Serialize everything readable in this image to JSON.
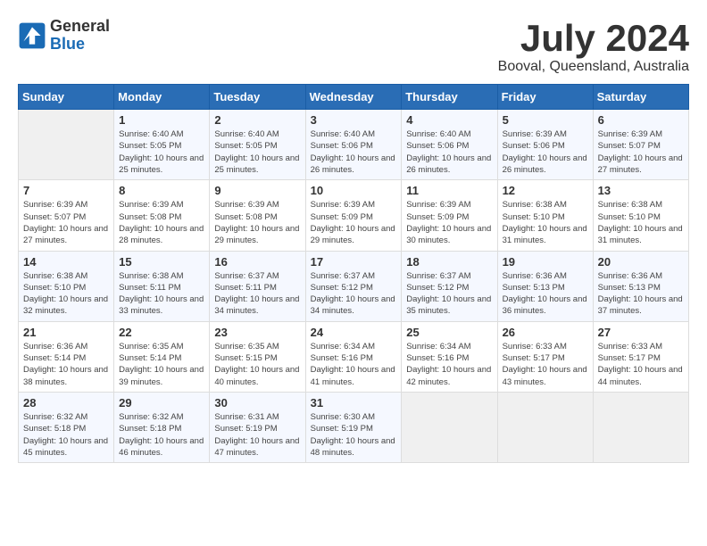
{
  "header": {
    "logo_general": "General",
    "logo_blue": "Blue",
    "month_year": "July 2024",
    "location": "Booval, Queensland, Australia"
  },
  "weekdays": [
    "Sunday",
    "Monday",
    "Tuesday",
    "Wednesday",
    "Thursday",
    "Friday",
    "Saturday"
  ],
  "weeks": [
    [
      {
        "day": "",
        "sunrise": "",
        "sunset": "",
        "daylight": ""
      },
      {
        "day": "1",
        "sunrise": "Sunrise: 6:40 AM",
        "sunset": "Sunset: 5:05 PM",
        "daylight": "Daylight: 10 hours and 25 minutes."
      },
      {
        "day": "2",
        "sunrise": "Sunrise: 6:40 AM",
        "sunset": "Sunset: 5:05 PM",
        "daylight": "Daylight: 10 hours and 25 minutes."
      },
      {
        "day": "3",
        "sunrise": "Sunrise: 6:40 AM",
        "sunset": "Sunset: 5:06 PM",
        "daylight": "Daylight: 10 hours and 26 minutes."
      },
      {
        "day": "4",
        "sunrise": "Sunrise: 6:40 AM",
        "sunset": "Sunset: 5:06 PM",
        "daylight": "Daylight: 10 hours and 26 minutes."
      },
      {
        "day": "5",
        "sunrise": "Sunrise: 6:39 AM",
        "sunset": "Sunset: 5:06 PM",
        "daylight": "Daylight: 10 hours and 26 minutes."
      },
      {
        "day": "6",
        "sunrise": "Sunrise: 6:39 AM",
        "sunset": "Sunset: 5:07 PM",
        "daylight": "Daylight: 10 hours and 27 minutes."
      }
    ],
    [
      {
        "day": "7",
        "sunrise": "Sunrise: 6:39 AM",
        "sunset": "Sunset: 5:07 PM",
        "daylight": "Daylight: 10 hours and 27 minutes."
      },
      {
        "day": "8",
        "sunrise": "Sunrise: 6:39 AM",
        "sunset": "Sunset: 5:08 PM",
        "daylight": "Daylight: 10 hours and 28 minutes."
      },
      {
        "day": "9",
        "sunrise": "Sunrise: 6:39 AM",
        "sunset": "Sunset: 5:08 PM",
        "daylight": "Daylight: 10 hours and 29 minutes."
      },
      {
        "day": "10",
        "sunrise": "Sunrise: 6:39 AM",
        "sunset": "Sunset: 5:09 PM",
        "daylight": "Daylight: 10 hours and 29 minutes."
      },
      {
        "day": "11",
        "sunrise": "Sunrise: 6:39 AM",
        "sunset": "Sunset: 5:09 PM",
        "daylight": "Daylight: 10 hours and 30 minutes."
      },
      {
        "day": "12",
        "sunrise": "Sunrise: 6:38 AM",
        "sunset": "Sunset: 5:10 PM",
        "daylight": "Daylight: 10 hours and 31 minutes."
      },
      {
        "day": "13",
        "sunrise": "Sunrise: 6:38 AM",
        "sunset": "Sunset: 5:10 PM",
        "daylight": "Daylight: 10 hours and 31 minutes."
      }
    ],
    [
      {
        "day": "14",
        "sunrise": "Sunrise: 6:38 AM",
        "sunset": "Sunset: 5:10 PM",
        "daylight": "Daylight: 10 hours and 32 minutes."
      },
      {
        "day": "15",
        "sunrise": "Sunrise: 6:38 AM",
        "sunset": "Sunset: 5:11 PM",
        "daylight": "Daylight: 10 hours and 33 minutes."
      },
      {
        "day": "16",
        "sunrise": "Sunrise: 6:37 AM",
        "sunset": "Sunset: 5:11 PM",
        "daylight": "Daylight: 10 hours and 34 minutes."
      },
      {
        "day": "17",
        "sunrise": "Sunrise: 6:37 AM",
        "sunset": "Sunset: 5:12 PM",
        "daylight": "Daylight: 10 hours and 34 minutes."
      },
      {
        "day": "18",
        "sunrise": "Sunrise: 6:37 AM",
        "sunset": "Sunset: 5:12 PM",
        "daylight": "Daylight: 10 hours and 35 minutes."
      },
      {
        "day": "19",
        "sunrise": "Sunrise: 6:36 AM",
        "sunset": "Sunset: 5:13 PM",
        "daylight": "Daylight: 10 hours and 36 minutes."
      },
      {
        "day": "20",
        "sunrise": "Sunrise: 6:36 AM",
        "sunset": "Sunset: 5:13 PM",
        "daylight": "Daylight: 10 hours and 37 minutes."
      }
    ],
    [
      {
        "day": "21",
        "sunrise": "Sunrise: 6:36 AM",
        "sunset": "Sunset: 5:14 PM",
        "daylight": "Daylight: 10 hours and 38 minutes."
      },
      {
        "day": "22",
        "sunrise": "Sunrise: 6:35 AM",
        "sunset": "Sunset: 5:14 PM",
        "daylight": "Daylight: 10 hours and 39 minutes."
      },
      {
        "day": "23",
        "sunrise": "Sunrise: 6:35 AM",
        "sunset": "Sunset: 5:15 PM",
        "daylight": "Daylight: 10 hours and 40 minutes."
      },
      {
        "day": "24",
        "sunrise": "Sunrise: 6:34 AM",
        "sunset": "Sunset: 5:16 PM",
        "daylight": "Daylight: 10 hours and 41 minutes."
      },
      {
        "day": "25",
        "sunrise": "Sunrise: 6:34 AM",
        "sunset": "Sunset: 5:16 PM",
        "daylight": "Daylight: 10 hours and 42 minutes."
      },
      {
        "day": "26",
        "sunrise": "Sunrise: 6:33 AM",
        "sunset": "Sunset: 5:17 PM",
        "daylight": "Daylight: 10 hours and 43 minutes."
      },
      {
        "day": "27",
        "sunrise": "Sunrise: 6:33 AM",
        "sunset": "Sunset: 5:17 PM",
        "daylight": "Daylight: 10 hours and 44 minutes."
      }
    ],
    [
      {
        "day": "28",
        "sunrise": "Sunrise: 6:32 AM",
        "sunset": "Sunset: 5:18 PM",
        "daylight": "Daylight: 10 hours and 45 minutes."
      },
      {
        "day": "29",
        "sunrise": "Sunrise: 6:32 AM",
        "sunset": "Sunset: 5:18 PM",
        "daylight": "Daylight: 10 hours and 46 minutes."
      },
      {
        "day": "30",
        "sunrise": "Sunrise: 6:31 AM",
        "sunset": "Sunset: 5:19 PM",
        "daylight": "Daylight: 10 hours and 47 minutes."
      },
      {
        "day": "31",
        "sunrise": "Sunrise: 6:30 AM",
        "sunset": "Sunset: 5:19 PM",
        "daylight": "Daylight: 10 hours and 48 minutes."
      },
      {
        "day": "",
        "sunrise": "",
        "sunset": "",
        "daylight": ""
      },
      {
        "day": "",
        "sunrise": "",
        "sunset": "",
        "daylight": ""
      },
      {
        "day": "",
        "sunrise": "",
        "sunset": "",
        "daylight": ""
      }
    ]
  ]
}
